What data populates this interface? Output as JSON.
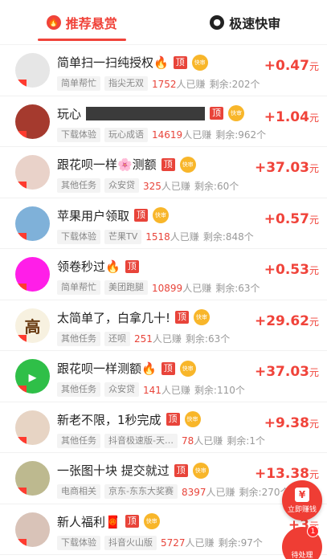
{
  "tabs": [
    {
      "label": "推荐悬赏",
      "icon": "flame-icon",
      "active": true
    },
    {
      "label": "极速快审",
      "icon": "user-icon",
      "active": false
    }
  ],
  "chips": {
    "top": "顶",
    "fast": "快审"
  },
  "done_suffix": "人已赚",
  "items": [
    {
      "title": "简单扫一扫纯授权🔥",
      "tag1": "简单帮忙",
      "tag2": "指尖无双",
      "done": "1752",
      "remain": "剩余:202个",
      "amount": "+0.47",
      "unit": "元",
      "avatar_bg": "#e6e6e6",
      "avatar_text": "",
      "fast": true
    },
    {
      "title": "玩心",
      "redacted": true,
      "tag1": "下载体验",
      "tag2": "玩心成语",
      "done": "14619",
      "remain": "剩余:962个",
      "amount": "+1.04",
      "unit": "元",
      "avatar_bg": "#a53a2e",
      "avatar_text": "",
      "fast": true
    },
    {
      "title": "跟花呗一样🌸测额",
      "tag1": "其他任务",
      "tag2": "众安贷",
      "done": "325",
      "remain": "剩余:60个",
      "amount": "+37.03",
      "unit": "元",
      "avatar_bg": "#e9d2c9",
      "avatar_text": "",
      "fast": true
    },
    {
      "title": "苹果用户领取",
      "tag1": "下载体验",
      "tag2": "芒果TV",
      "done": "1518",
      "remain": "剩余:848个",
      "amount": "+0.57",
      "unit": "元",
      "avatar_bg": "#7fb1d9",
      "avatar_text": "",
      "fast": true
    },
    {
      "title": "领卷秒过🔥",
      "tag1": "简单帮忙",
      "tag2": "美团跑腿",
      "done": "10899",
      "remain": "剩余:63个",
      "amount": "+0.53",
      "unit": "元",
      "avatar_bg": "#ff1ee8",
      "avatar_text": "",
      "fast": false
    },
    {
      "title": "太简单了，白拿几十!",
      "tag1": "其他任务",
      "tag2": "还呗",
      "done": "251",
      "remain": "剩余:63个",
      "amount": "+29.62",
      "unit": "元",
      "avatar_bg": "#f7f1e0",
      "avatar_text": "高",
      "fast": true
    },
    {
      "title": "跟花呗一样测额🔥",
      "tag1": "其他任务",
      "tag2": "众安贷",
      "done": "141",
      "remain": "剩余:110个",
      "amount": "+37.03",
      "unit": "元",
      "avatar_bg": "#2fbf48",
      "avatar_text": "▸",
      "fast": true
    },
    {
      "title": "新老不限，1秒完成",
      "tag1": "其他任务",
      "tag2": "抖音极速版-天…",
      "done": "78",
      "remain": "剩余:1个",
      "amount": "+9.38",
      "unit": "元",
      "avatar_bg": "#e7d4c4",
      "avatar_text": "",
      "fast": true
    },
    {
      "title": "一张图十块 提交就过",
      "tag1": "电商相关",
      "tag2": "京东-东东大奖赛",
      "done": "8397",
      "remain": "剩余:270个",
      "amount": "+13.38",
      "unit": "元",
      "avatar_bg": "#bdb98f",
      "avatar_text": "",
      "fast": true
    },
    {
      "title": "新人福利🧧",
      "tag1": "下载体验",
      "tag2": "抖音火山版",
      "done": "5727",
      "remain": "剩余:97个",
      "amount": "+3",
      "unit": "元",
      "avatar_bg": "#d9c3b8",
      "avatar_text": "",
      "fast": true
    }
  ],
  "fab_earn": {
    "label": "立即赚钱",
    "icon": "¥"
  },
  "fab_pending": {
    "label": "待处理",
    "count": "1"
  },
  "colors": {
    "accent": "#f0433a",
    "fast_badge": "#f8b62a"
  }
}
